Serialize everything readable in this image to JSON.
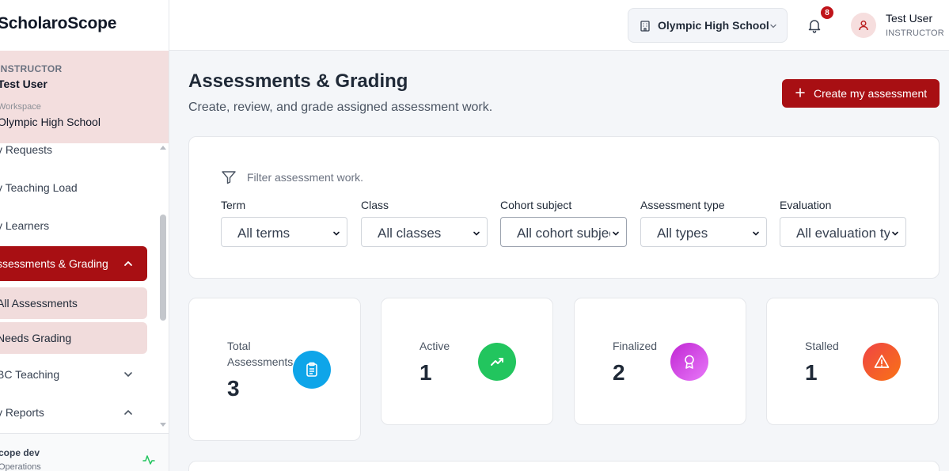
{
  "app": {
    "brand": "ScholaroScope"
  },
  "sidebar": {
    "user": {
      "role": "INSTRUCTOR",
      "name": "Test User",
      "workspace_label": "Workspace",
      "workspace": "Olympic High School"
    },
    "items": [
      {
        "label": "y Requests"
      },
      {
        "label": "y Teaching Load"
      },
      {
        "label": "y Learners"
      },
      {
        "label": "ssessments & Grading"
      },
      {
        "label": "All Assessments"
      },
      {
        "label": "Needs Grading"
      },
      {
        "label": "BC Teaching"
      },
      {
        "label": "y Reports"
      }
    ],
    "footer": {
      "title": "cope dev",
      "subtitle": "Operations"
    }
  },
  "topbar": {
    "school": "Olympic High School",
    "notifications": "8",
    "user_name": "Test User",
    "user_role": "INSTRUCTOR"
  },
  "main": {
    "title": "Assessments & Grading",
    "subtitle": "Create, review, and grade assigned assessment work.",
    "create_label": "Create my assessment"
  },
  "filters": {
    "heading": "Filter assessment work.",
    "fields": [
      {
        "label": "Term",
        "value": "All terms"
      },
      {
        "label": "Class",
        "value": "All classes"
      },
      {
        "label": "Cohort subject",
        "value": "All cohort subjects"
      },
      {
        "label": "Assessment type",
        "value": "All types"
      },
      {
        "label": "Evaluation",
        "value": "All evaluation types"
      }
    ]
  },
  "stats": [
    {
      "label": "Total Assessments",
      "value": "3",
      "color": "#0ea5e9",
      "icon": "clipboard-icon"
    },
    {
      "label": "Active",
      "value": "1",
      "color": "#22c55e",
      "icon": "trending-up-icon"
    },
    {
      "label": "Finalized",
      "value": "2",
      "color": "#d946ef",
      "icon": "award-icon"
    },
    {
      "label": "Stalled",
      "value": "1",
      "color": "#f97316",
      "icon": "alert-triangle-icon"
    }
  ]
}
